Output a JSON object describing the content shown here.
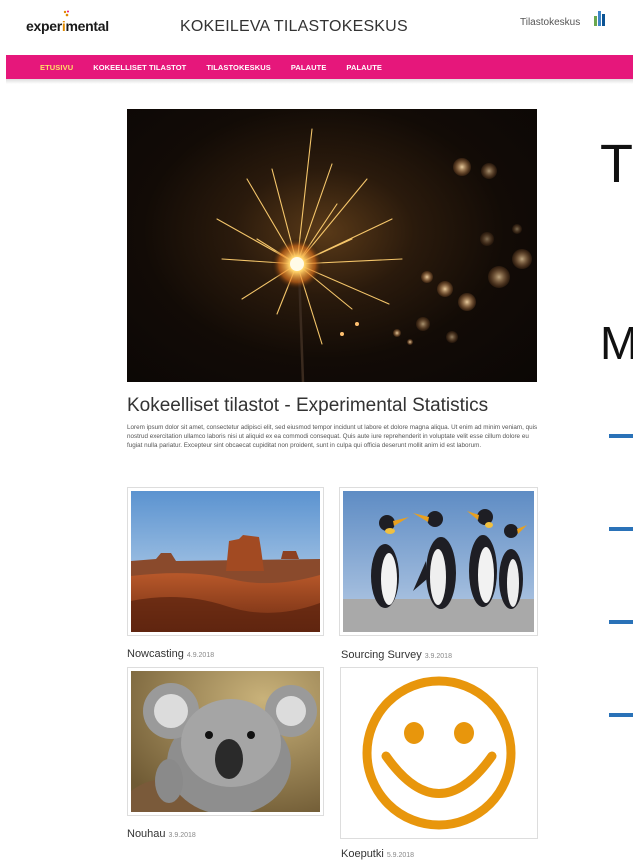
{
  "header": {
    "logo": "experimental",
    "title": "KOKEILEVA TILASTOKESKUS",
    "partner_logo": "Tilastokeskus"
  },
  "nav": {
    "items": [
      {
        "label": "ETUSIVU",
        "active": true
      },
      {
        "label": "KOKEELLISET TILASTOT",
        "active": false
      },
      {
        "label": "TILASTOKESKUS",
        "active": false
      },
      {
        "label": "PALAUTE",
        "active": false
      },
      {
        "label": "PALAUTE",
        "active": false
      }
    ]
  },
  "hero": {
    "image": "sparkler-photo",
    "title": "Kokeelliset tilastot - Experimental Statistics",
    "text": "Lorem ipsum dolor sit amet, consectetur adipisci elit, sed eiusmod tempor incidunt ut labore et dolore magna aliqua. Ut enim ad minim veniam, quis nostrud exercitation ullamco laboris nisi ut aliquid ex ea commodi consequat. Quis aute iure reprehenderit in voluptate velit esse cillum dolore eu fugiat nulla pariatur. Excepteur sint obcaecat cupiditat non proident, sunt in culpa qui officia deserunt mollit anim id est laborum."
  },
  "cards": [
    {
      "image": "desert-mesa-photo",
      "title": "Nowcasting",
      "date": "4.9.2018"
    },
    {
      "image": "penguins-photo",
      "title": "Sourcing Survey",
      "date": "3.9.2018"
    },
    {
      "image": "koala-photo",
      "title": "Nouhau",
      "date": "3.9.2018"
    },
    {
      "image": "smiley-face",
      "title": "Koeputki",
      "date": "5.9.2018"
    }
  ],
  "slide_fragment": {
    "letter_top": "T",
    "letter_mid": "M"
  },
  "colors": {
    "nav_bg": "#e6177b",
    "nav_active": "#ffe066",
    "smiley": "#e8960c",
    "slide_accent": "#2a72b8"
  }
}
